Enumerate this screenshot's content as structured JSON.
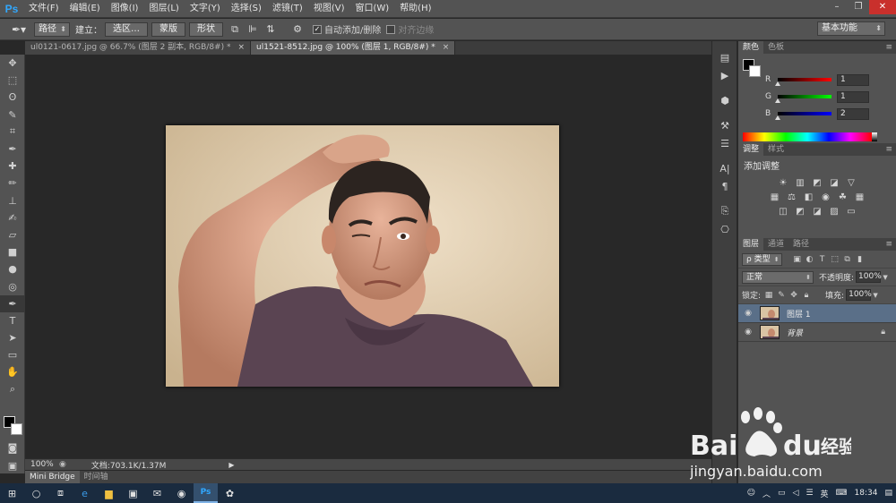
{
  "app": {
    "logo": "Ps"
  },
  "menu": [
    "文件(F)",
    "编辑(E)",
    "图像(I)",
    "图层(L)",
    "文字(Y)",
    "选择(S)",
    "滤镜(T)",
    "视图(V)",
    "窗口(W)",
    "帮助(H)"
  ],
  "window_controls": {
    "minimize": "–",
    "restore": "❐",
    "close": "✕"
  },
  "options": {
    "tool_icon": "pen-icon",
    "mode_select": "路径",
    "make_label": "建立：",
    "selection_button": "选区…",
    "mask_button": "蒙版",
    "shape_button": "形状",
    "auto_add_delete": "自动添加/删除",
    "align_edges": "对齐边缘",
    "workspace": "基本功能"
  },
  "tabs": [
    {
      "label": "ul0121-0617.jpg @ 66.7% (图层 2 副本, RGB/8#) *",
      "active": false
    },
    {
      "label": "ul1521-8512.jpg @ 100% (图层 1, RGB/8#) *",
      "active": true
    }
  ],
  "tab_close": "×",
  "tools": [
    "move-icon",
    "marquee-icon",
    "lasso-icon",
    "quick-select-icon",
    "crop-icon",
    "eyedropper-icon",
    "healing-icon",
    "brush-icon",
    "stamp-icon",
    "history-brush-icon",
    "eraser-icon",
    "gradient-icon",
    "blur-icon",
    "dodge-icon",
    "pen-icon",
    "type-icon",
    "path-select-icon",
    "shape-icon",
    "hand-icon",
    "zoom-icon"
  ],
  "tool_glyphs": [
    "✥",
    "⬚",
    "ʘ",
    "✎",
    "⌗",
    "✒",
    "✚",
    "✏",
    "⊥",
    "✍",
    "▱",
    "■",
    "●",
    "◎",
    "✒",
    "T",
    "➤",
    "▭",
    "✋",
    "⌕"
  ],
  "status": {
    "zoom": "100%",
    "doc_info": "文档:703.1K/1.37M",
    "arrow": "▶"
  },
  "bottom_tabs": [
    "Mini Bridge",
    "时间轴"
  ],
  "color_panel": {
    "tabs": [
      "颜色",
      "色板"
    ],
    "sliders": [
      {
        "label": "R",
        "value": "1",
        "gradient": "linear-gradient(to right,#000,#f00)"
      },
      {
        "label": "G",
        "value": "1",
        "gradient": "linear-gradient(to right,#000,#0f0)"
      },
      {
        "label": "B",
        "value": "2",
        "gradient": "linear-gradient(to right,#000,#00f)"
      }
    ]
  },
  "adjust_panel": {
    "tabs": [
      "调整",
      "样式"
    ],
    "title": "添加调整",
    "row1": [
      "☀",
      "▥",
      "◩",
      "◪",
      "▽"
    ],
    "row2": [
      "▦",
      "⚖",
      "◧",
      "◉",
      "☘",
      "▦"
    ],
    "row3": [
      "◫",
      "◩",
      "◪",
      "▨",
      "▭"
    ]
  },
  "layers_panel": {
    "tabs": [
      "图层",
      "通道",
      "路径"
    ],
    "filter_select": "ρ 类型",
    "blend_mode": "正常",
    "opacity_label": "不透明度:",
    "opacity": "100%",
    "lock_label": "锁定:",
    "fill_label": "填充:",
    "fill": "100%",
    "layers": [
      {
        "name": "图层 1",
        "selected": true,
        "italic": false,
        "locked": false
      },
      {
        "name": "背景",
        "selected": false,
        "italic": true,
        "locked": true
      }
    ]
  },
  "panel_menu": "≡",
  "watermark": {
    "brand": "Bai",
    "brand2": "du",
    "cn": "经验",
    "url": "jingyan.baidu.com"
  },
  "taskbar": {
    "tray": [
      "英",
      "18:34"
    ]
  }
}
